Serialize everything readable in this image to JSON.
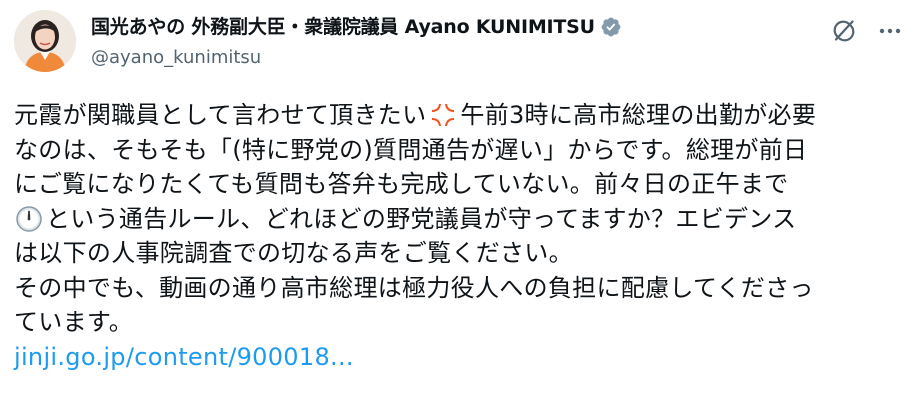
{
  "author": {
    "display_name": "国光あやの 外務副大臣・衆議院議員 Ayano KUNIMITSU",
    "handle": "@ayano_kunimitsu"
  },
  "header_actions": {
    "grok_icon": "grok-icon",
    "more_icon": "more-options-icon"
  },
  "post": {
    "lines": [
      {
        "before": "元霞が関職員として言わせて頂きたい",
        "emoji": "anger-symbol-icon",
        "after": "午前3時に高市総理の出勤が必要"
      },
      {
        "text": "なのは、そもそも「(特に野党の)質問通告が遅い」からです。総理が前日"
      },
      {
        "text": "にご覧になりたくても質問も答弁も完成していない。前々日の正午まで"
      },
      {
        "emoji": "clock-icon",
        "after": "という通告ルール、どれほどの野党議員が守ってますか？エビデンス"
      },
      {
        "text": "は以下の人事院調査での切なる声をご覧ください。"
      },
      {
        "text": "その中でも、動画の通り高市総理は極力役人への負担に配慮してくださっ"
      },
      {
        "text": "ています。"
      }
    ],
    "link_text": "jinji.go.jp/content/900018..."
  },
  "colors": {
    "text": "#0f1419",
    "secondary": "#536471",
    "link": "#1d9bf0",
    "verified": "#829aab",
    "anger_emoji": "#f4511e"
  }
}
